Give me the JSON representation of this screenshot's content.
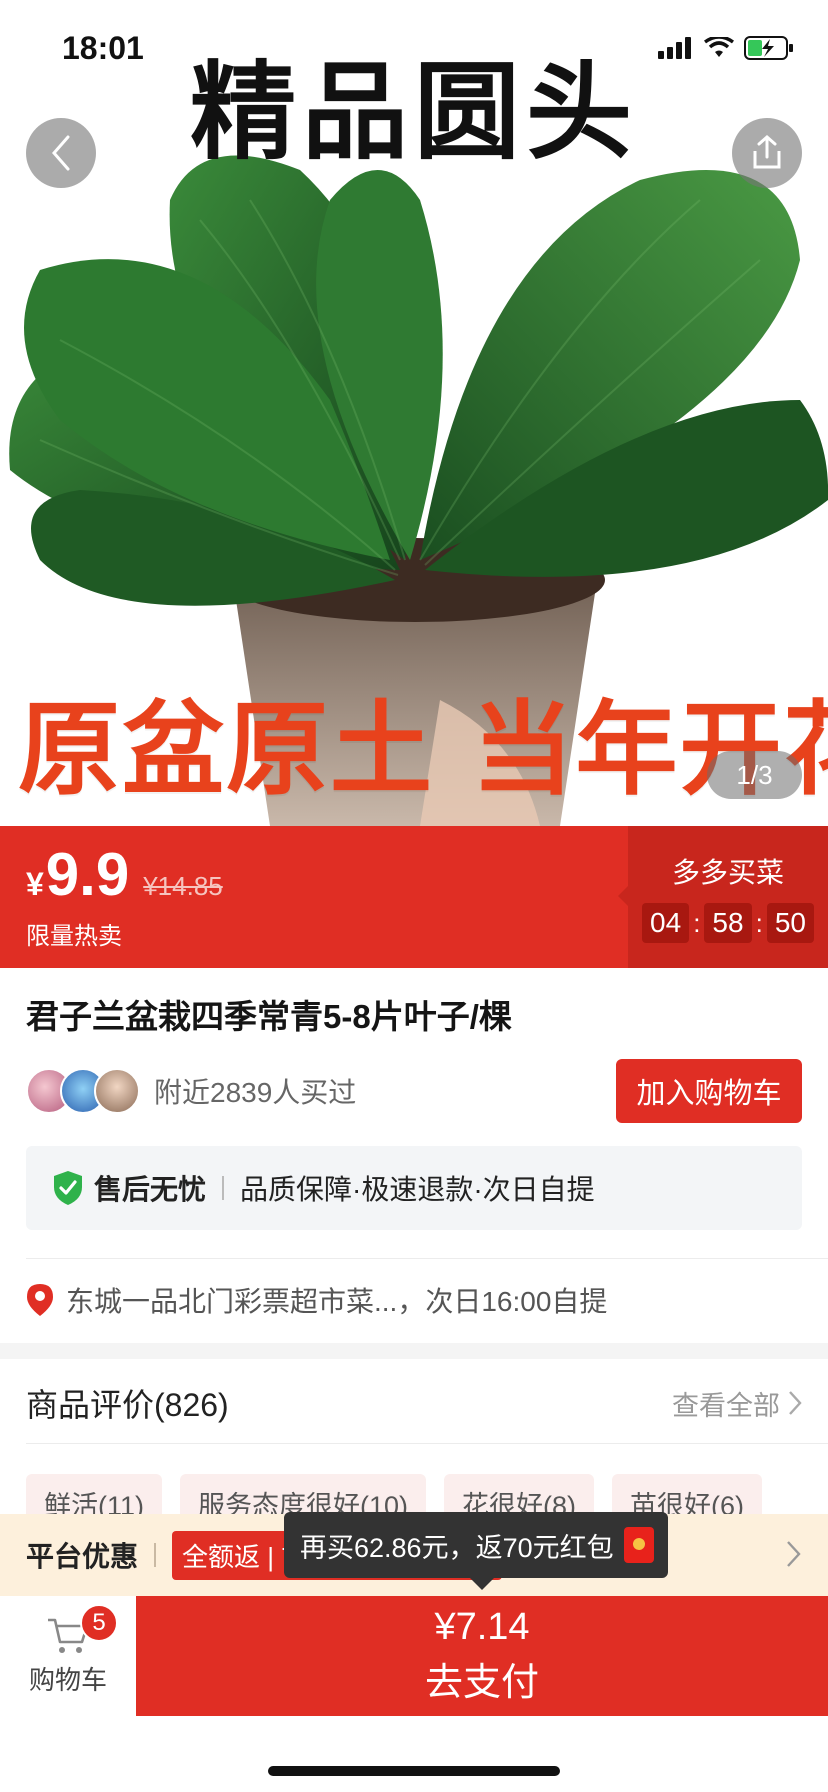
{
  "status_bar": {
    "time": "18:01"
  },
  "hero": {
    "headline": "精品圆头",
    "slogan": "原盆原土 当年开花",
    "pager": "1/3"
  },
  "price": {
    "currency": "¥",
    "current": "9.9",
    "original": "¥14.85",
    "tag": "限量热卖",
    "promo_title": "多多买菜",
    "countdown": {
      "h": "04",
      "m": "58",
      "s": "50"
    }
  },
  "product": {
    "title": "君子兰盆栽四季常青5-8片叶子/棵",
    "buyers_text": "附近2839人买过",
    "add_cart_label": "加入购物车"
  },
  "guarantee": {
    "title": "售后无忧",
    "items": "品质保障·极速退款·次日自提"
  },
  "pickup": {
    "text": "东城一品北门彩票超市菜...，次日16:00自提"
  },
  "reviews": {
    "title": "商品评价(826)",
    "view_all": "查看全部",
    "tags": [
      {
        "label": "鲜活(11)"
      },
      {
        "label": "服务态度很好(10)"
      },
      {
        "label": "花很好(8)"
      },
      {
        "label": "苗很好(6)"
      }
    ]
  },
  "platform": {
    "title": "平台优惠",
    "tag": "全额返 | 70元红包即将失效"
  },
  "tooltip": {
    "text": "再买62.86元，返70元红包"
  },
  "bottom": {
    "cart_label": "购物车",
    "cart_count": "5",
    "pay_amount": "¥7.14",
    "pay_label": "去支付"
  },
  "colors": {
    "brand_red": "#e02e24",
    "promo_dark_red": "#c8261d",
    "slogan_orange": "#e8421c",
    "promo_strip_bg": "#fdf0dc"
  },
  "icons": [
    "back-arrow-icon",
    "share-icon",
    "shield-check-icon",
    "location-pin-icon",
    "chevron-right-icon",
    "cart-icon",
    "red-packet-icon",
    "signal-icon",
    "wifi-icon",
    "battery-icon"
  ]
}
